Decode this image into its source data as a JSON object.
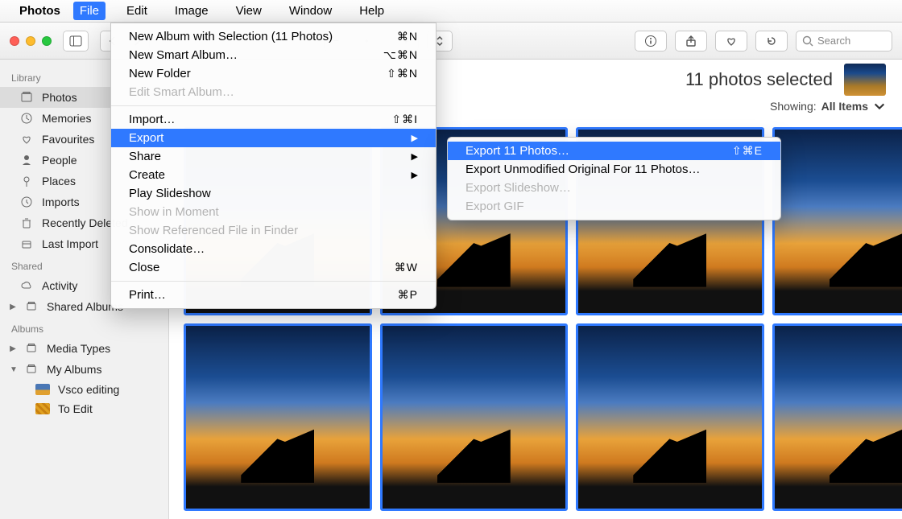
{
  "menubar": {
    "app": "Photos",
    "items": [
      "File",
      "Edit",
      "Image",
      "View",
      "Window",
      "Help"
    ],
    "active": "File"
  },
  "toolbar": {
    "search_placeholder": "Search"
  },
  "sidebar": {
    "sections": [
      {
        "title": "Library",
        "items": [
          {
            "label": "Photos",
            "icon": "photos",
            "sel": true
          },
          {
            "label": "Memories",
            "icon": "clock"
          },
          {
            "label": "Favourites",
            "icon": "heart"
          },
          {
            "label": "People",
            "icon": "person"
          },
          {
            "label": "Places",
            "icon": "pin"
          },
          {
            "label": "Imports",
            "icon": "clock2"
          },
          {
            "label": "Recently Deleted",
            "icon": "trash"
          },
          {
            "label": "Last Import",
            "icon": "box"
          }
        ]
      },
      {
        "title": "Shared",
        "items": [
          {
            "label": "Activity",
            "icon": "cloud"
          },
          {
            "label": "Shared Albums",
            "icon": "stack",
            "disc": "▶"
          }
        ]
      },
      {
        "title": "Albums",
        "items": [
          {
            "label": "Media Types",
            "icon": "stack",
            "disc": "▶"
          },
          {
            "label": "My Albums",
            "icon": "stack",
            "disc": "▼",
            "children": [
              {
                "label": "Vsco editing",
                "thumb": "sunset"
              },
              {
                "label": "To Edit",
                "thumb": "gold"
              }
            ]
          }
        ]
      }
    ]
  },
  "status": {
    "selected_text": "11 photos selected",
    "showing_label": "Showing:",
    "showing_value": "All Items"
  },
  "file_menu": [
    {
      "label": "New Album with Selection (11 Photos)",
      "sc": "⌘N"
    },
    {
      "label": "New Smart Album…",
      "sc": "⌥⌘N"
    },
    {
      "label": "New Folder",
      "sc": "⇧⌘N"
    },
    {
      "label": "Edit Smart Album…",
      "disabled": true
    },
    {
      "sep": true
    },
    {
      "label": "Import…",
      "sc": "⇧⌘I"
    },
    {
      "label": "Export",
      "arrow": true,
      "hl": true
    },
    {
      "label": "Share",
      "arrow": true
    },
    {
      "label": "Create",
      "arrow": true
    },
    {
      "label": "Play Slideshow"
    },
    {
      "label": "Show in Moment",
      "disabled": true
    },
    {
      "label": "Show Referenced File in Finder",
      "disabled": true
    },
    {
      "label": "Consolidate…"
    },
    {
      "label": "Close",
      "sc": "⌘W"
    },
    {
      "sep": true
    },
    {
      "label": "Print…",
      "sc": "⌘P"
    }
  ],
  "export_submenu": [
    {
      "label": "Export 11 Photos…",
      "sc": "⇧⌘E",
      "hl": true
    },
    {
      "label": "Export Unmodified Original For 11 Photos…"
    },
    {
      "label": "Export Slideshow…",
      "disabled": true
    },
    {
      "label": "Export GIF",
      "disabled": true
    }
  ]
}
